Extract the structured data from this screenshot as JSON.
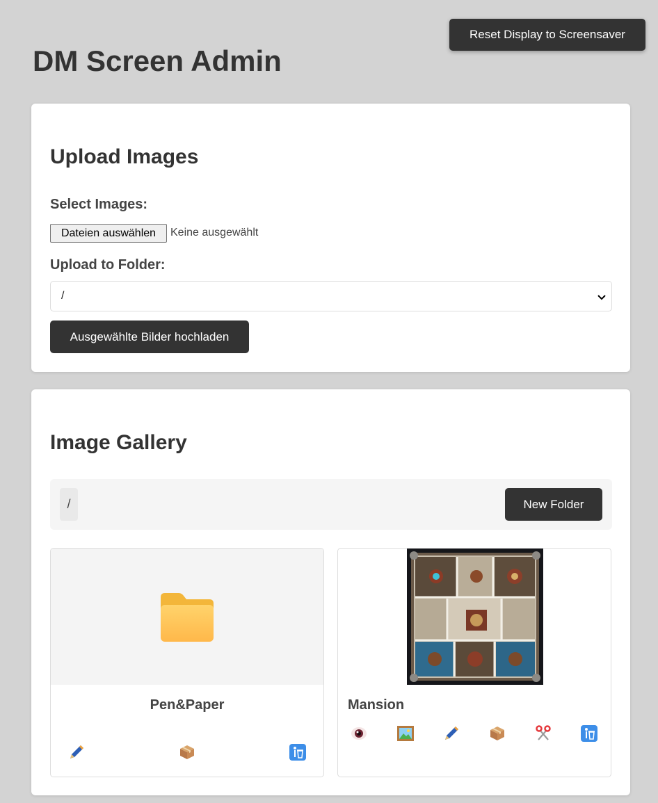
{
  "header": {
    "title": "DM Screen Admin",
    "reset_button": "Reset Display to Screensaver"
  },
  "upload": {
    "heading": "Upload Images",
    "select_label": "Select Images:",
    "file_button": "Dateien auswählen",
    "file_status": "Keine ausgewählt",
    "folder_label": "Upload to Folder:",
    "folder_value": "/",
    "submit_button": "Ausgewählte Bilder hochladen"
  },
  "gallery": {
    "heading": "Image Gallery",
    "breadcrumb": "/",
    "new_folder_button": "New Folder",
    "items": [
      {
        "type": "folder",
        "name": "Pen&Paper",
        "actions": [
          "pencil-icon",
          "package-icon",
          "trash-icon"
        ]
      },
      {
        "type": "image",
        "name": "Mansion",
        "actions": [
          "eye-icon",
          "picture-icon",
          "pencil-icon",
          "package-icon",
          "scissors-icon",
          "trash-icon"
        ]
      }
    ]
  },
  "colors": {
    "background": "#d3d3d3",
    "button": "#333333",
    "folder": "#ffc94d"
  }
}
